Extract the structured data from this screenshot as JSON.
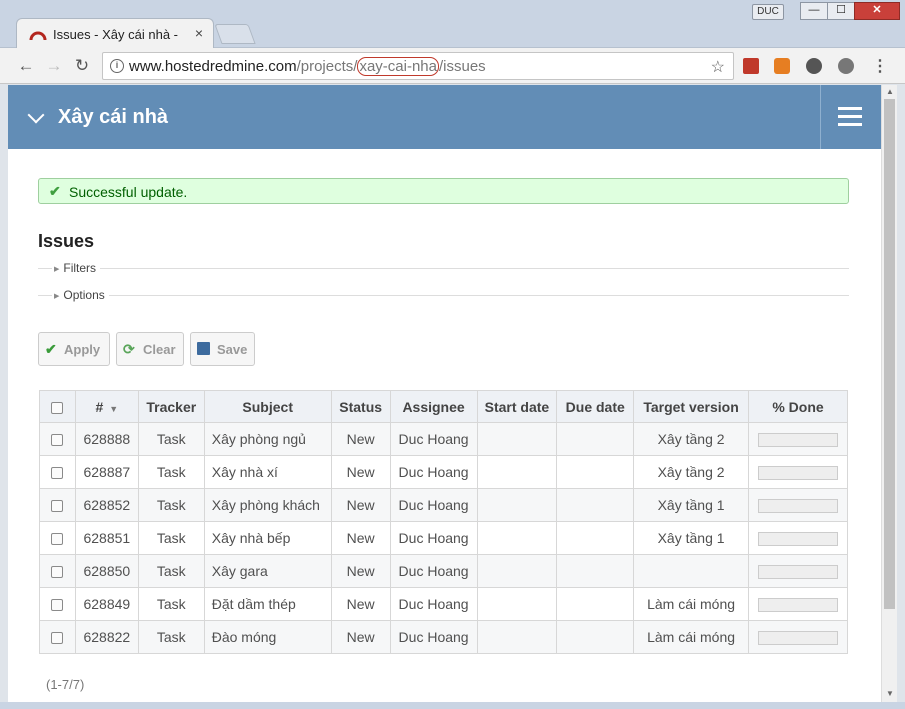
{
  "browser": {
    "tab_title": "Issues - Xây cái nhà -",
    "tab_close": "×",
    "profile": "DUC",
    "window": {
      "minimize": "—",
      "maximize": "☐",
      "close": "✕"
    },
    "url": {
      "host": "www.hostedredmine.com",
      "path1": "/projects/",
      "project": "xay-cai-nha",
      "path2": "/issues"
    }
  },
  "header": {
    "project_title": "Xây cái nhà"
  },
  "flash": {
    "message": "Successful update."
  },
  "page": {
    "title": "Issues"
  },
  "query": {
    "filters_label": "Filters",
    "options_label": "Options"
  },
  "buttons": {
    "apply": "Apply",
    "clear": "Clear",
    "save": "Save"
  },
  "table": {
    "columns": [
      "#",
      "Tracker",
      "Subject",
      "Status",
      "Assignee",
      "Start date",
      "Due date",
      "Target version",
      "% Done"
    ],
    "rows": [
      {
        "id": "628888",
        "tracker": "Task",
        "subject": "Xây phòng ngủ",
        "status": "New",
        "assignee": "Duc Hoang",
        "start": "",
        "due": "",
        "version": "Xây tầng 2",
        "done": 0
      },
      {
        "id": "628887",
        "tracker": "Task",
        "subject": "Xây nhà xí",
        "status": "New",
        "assignee": "Duc Hoang",
        "start": "",
        "due": "",
        "version": "Xây tầng 2",
        "done": 0
      },
      {
        "id": "628852",
        "tracker": "Task",
        "subject": "Xây phòng khách",
        "status": "New",
        "assignee": "Duc Hoang",
        "start": "",
        "due": "",
        "version": "Xây tầng 1",
        "done": 0
      },
      {
        "id": "628851",
        "tracker": "Task",
        "subject": "Xây nhà bếp",
        "status": "New",
        "assignee": "Duc Hoang",
        "start": "",
        "due": "",
        "version": "Xây tầng 1",
        "done": 0
      },
      {
        "id": "628850",
        "tracker": "Task",
        "subject": "Xây gara",
        "status": "New",
        "assignee": "Duc Hoang",
        "start": "",
        "due": "",
        "version": "",
        "done": 0
      },
      {
        "id": "628849",
        "tracker": "Task",
        "subject": "Đặt dầm thép",
        "status": "New",
        "assignee": "Duc Hoang",
        "start": "",
        "due": "",
        "version": "Làm cái móng",
        "done": 0
      },
      {
        "id": "628822",
        "tracker": "Task",
        "subject": "Đào móng",
        "status": "New",
        "assignee": "Duc Hoang",
        "start": "",
        "due": "",
        "version": "Làm cái móng",
        "done": 0
      }
    ]
  },
  "pagination": {
    "text": "(1-7/7)"
  },
  "colors": {
    "header_bg": "#628db6",
    "flash_bg": "#dfffdf",
    "flash_text": "#005f00",
    "url_highlight": "#c0392b"
  }
}
